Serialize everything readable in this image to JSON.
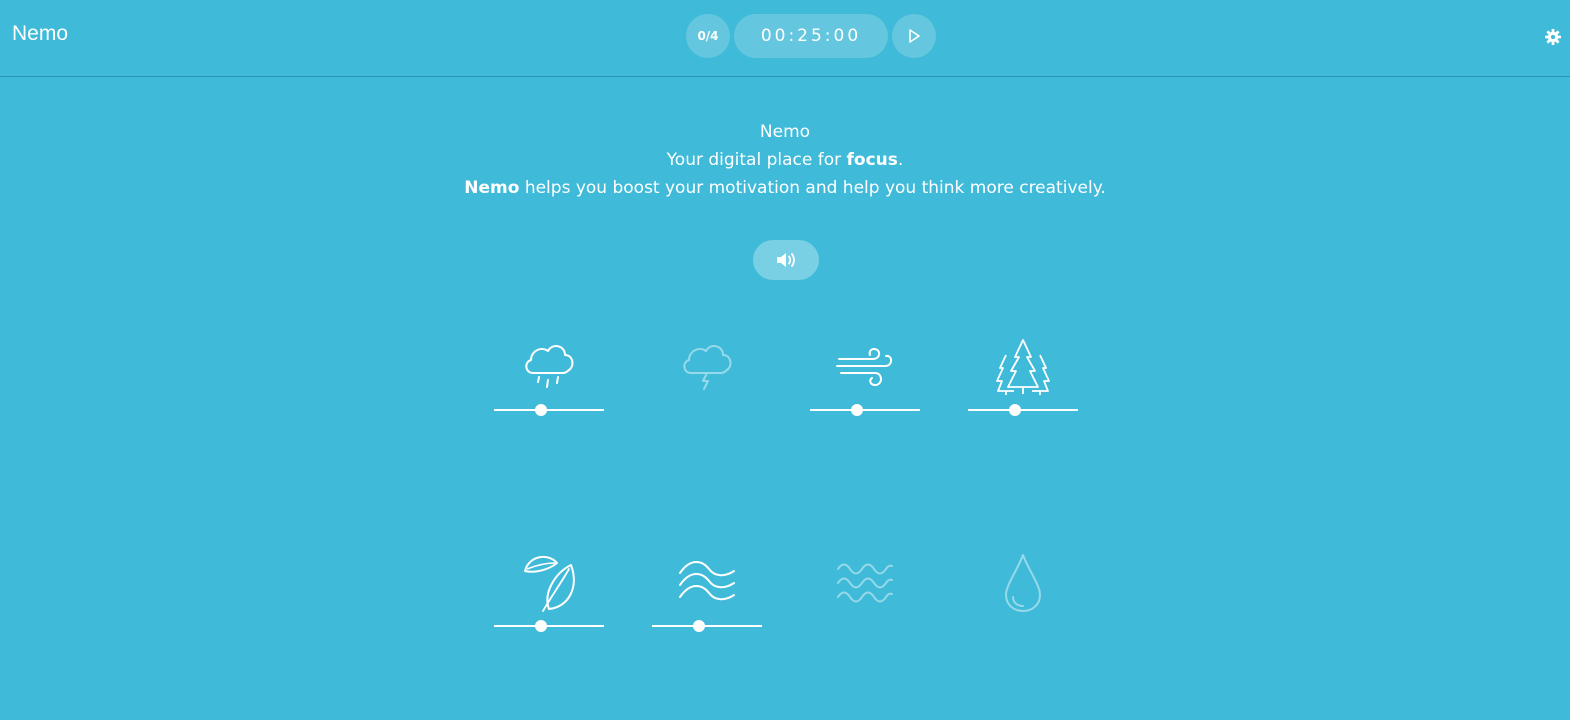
{
  "header": {
    "app_title": "Nemo",
    "session_count": "0/4",
    "timer": "00:25:00",
    "play_icon": "play-icon",
    "settings_icon": "gear-icon"
  },
  "intro": {
    "line1": "Nemo",
    "line2_prefix": "Your digital place for ",
    "line2_bold": "focus",
    "line2_suffix": ".",
    "line3_bold": "Nemo",
    "line3_rest": " helps you boost your motivation and help you think more creatively."
  },
  "volume_icon": "speaker-icon",
  "sounds": [
    {
      "name": "rain",
      "icon": "rain-cloud-icon",
      "active": true,
      "level": 0.43
    },
    {
      "name": "thunderstorm",
      "icon": "thunder-cloud-icon",
      "active": false
    },
    {
      "name": "wind",
      "icon": "wind-icon",
      "active": true,
      "level": 0.43
    },
    {
      "name": "forest",
      "icon": "forest-icon",
      "active": true,
      "level": 0.43
    },
    {
      "name": "leaves",
      "icon": "leaf-icon",
      "active": true,
      "level": 0.43
    },
    {
      "name": "stream",
      "icon": "stream-waves-icon",
      "active": true,
      "level": 0.43
    },
    {
      "name": "waves",
      "icon": "ocean-waves-icon",
      "active": false
    },
    {
      "name": "water-drop",
      "icon": "water-drop-icon",
      "active": false
    }
  ],
  "colors": {
    "background": "#3fbad8",
    "foreground": "#ffffff"
  }
}
